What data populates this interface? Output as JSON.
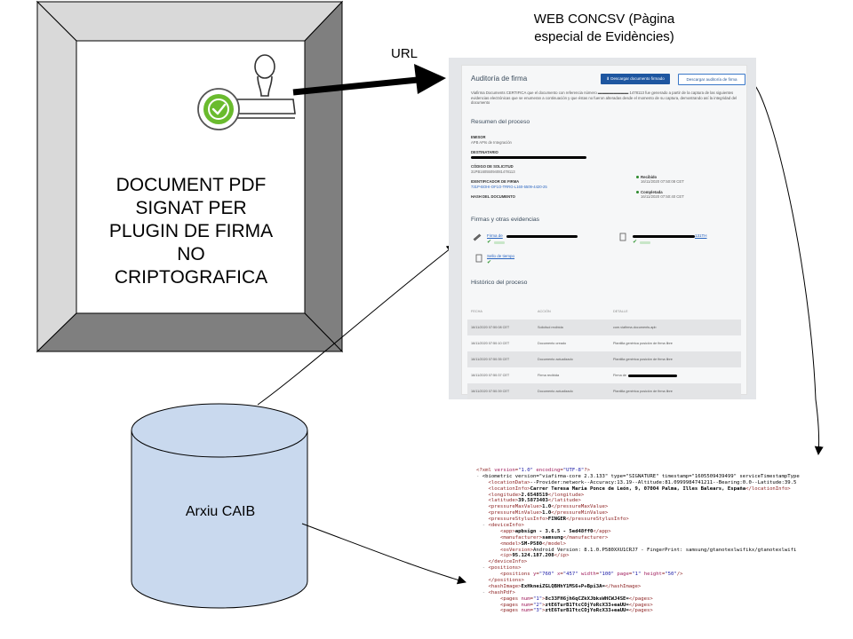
{
  "document_box": {
    "label": "DOCUMENT PDF\nSIGNAT PER\nPLUGIN DE FIRMA\nNO\nCRIPTOGRAFICA"
  },
  "arrow_label": "URL",
  "database": {
    "label": "Arxiu CAIB"
  },
  "web_title": "WEB CONCSV (Pàgina\nespecial de Evidències)",
  "web_page": {
    "title": "Auditoría de firma",
    "btn_download_signed": "Descargar documento firmado",
    "btn_download_audit": "Descargar auditoría de firma",
    "intro_text": "Viafirma Documents CERTIFICA que el documento con referencia número ▬▬▬▬▬▬▬▬ 1478113 fue generado a partir de la captura de las siguientes evidencias electrónicas que se enumeran a continuación y que éstas no fueron alteradas desde el momento de su captura, demostrando así la integridad del documento",
    "summary_title": "Resumen del proceso",
    "emisor_label": "EMISOR",
    "emisor_value": "APB APIs de Integración",
    "destinatario_label": "DESTINATARIO",
    "codigo_label": "CÓDIGO DE SOLICITUD",
    "codigo_value": "31PB16055094081478113",
    "identificador_label": "IDENTIFICADOR DE FIRMA",
    "identificador_value": "731P-BOHI-OF1O-TRRG-L160-5509-4420-25",
    "hash_label": "HASH DEL DOCUMENTO",
    "recibido_label": "Recibido",
    "recibido_value": "16/11/2020 07:50:08 CET",
    "completada_label": "Completada",
    "completada_value": "16/11/2020 07:50:40 CET",
    "evidencias_title": "Firmas y otras evidencias",
    "firma_link_1": "Firma de",
    "firma_link_2": "131TH",
    "sello_link": "Sello de tiempo",
    "historico_title": "Histórico del proceso",
    "history_headers": [
      "FECHA",
      "ACCIÓN",
      "DETALLE"
    ],
    "history_rows": [
      [
        "16/11/2020 07:50:08 CET",
        "Solicitud recibida",
        "com.viafirma.documents.apb"
      ],
      [
        "16/11/2020 07:50:10 CET",
        "Documento creado",
        "Plantilla genérica posición de firma libre"
      ],
      [
        "16/11/2020 07:50:35 CET",
        "Documento actualizado",
        "Plantilla genérica posición de firma libre"
      ],
      [
        "16/11/2020 07:50:37 CET",
        "Firma recibida",
        "Firma de"
      ],
      [
        "16/11/2020 07:50:39 CET",
        "Documento actualizado",
        "Plantilla genérica posición de firma libre"
      ]
    ]
  },
  "xml_lines": [
    "<?xml version=\"1.0\" encoding=\"UTF-8\"?>",
    "- <biometric version=\"viafirma-core 2.3.133\" type=\"SIGNATURE\" timestamp=\"1605509439499\" serviceTimestampType",
    "    <locationData>--Provider:network--Accuracy:13.19--Altitude:81.0999984741211--Bearing:0.0--Latitude:39.5",
    "    <locationInfo>Carrer Teresa Maria Ponce de León, 9, 07004 Palma, Illes Balears, España</locationInfo>",
    "    <longitude>2.6548519</longitude>",
    "    <latitude>39.5873403</latitude>",
    "    <pressureMaxValue>1.0</pressureMaxValue>",
    "    <pressureMinValue>1.0</pressureMinValue>",
    "    <pressureStylusInfo>FINGER</pressureStylusInfo>",
    "  - <deviceInfo>",
    "        <app>apbsign - 3.6.5 - 5ed48ff0</app>",
    "        <manufacturer>samsung</manufacturer>",
    "        <model>SM-P580</model>",
    "        <osVersion>Android Version: 8.1.0.P580XXU1CRJ7 - FingerPrint: samsung/gtanotexlwifikx/gtanotexlwifi",
    "        <ip>95.124.187.208</ip>",
    "    </deviceInfo>",
    "  - <positions>",
    "        <positions y=\"760\" x=\"457\" width=\"100\" page=\"1\" height=\"50\"/>",
    "    </positions>",
    "    <hashImage>ExHkneiZGLQBHhY1MS6+P+Bpi3A=</hashImage>",
    "  - <hashPdf>",
    "        <pages num=\"1\">8c33FH6jh6qCZkXJbksWHCWJ4SE=</pages>",
    "        <pages num=\"2\">ztE6TurB1TtcCOjYoRcX33+eaUU=</pages>",
    "        <pages num=\"3\">ztE6TurB1TtcCOjYoRcX33+eaUU=</pages>"
  ],
  "colors": {
    "frame_dark": "#7f7f7f",
    "frame_light": "#d9d9d9",
    "database_fill": "#c9d9ee",
    "button_blue": "#1e56a0"
  }
}
